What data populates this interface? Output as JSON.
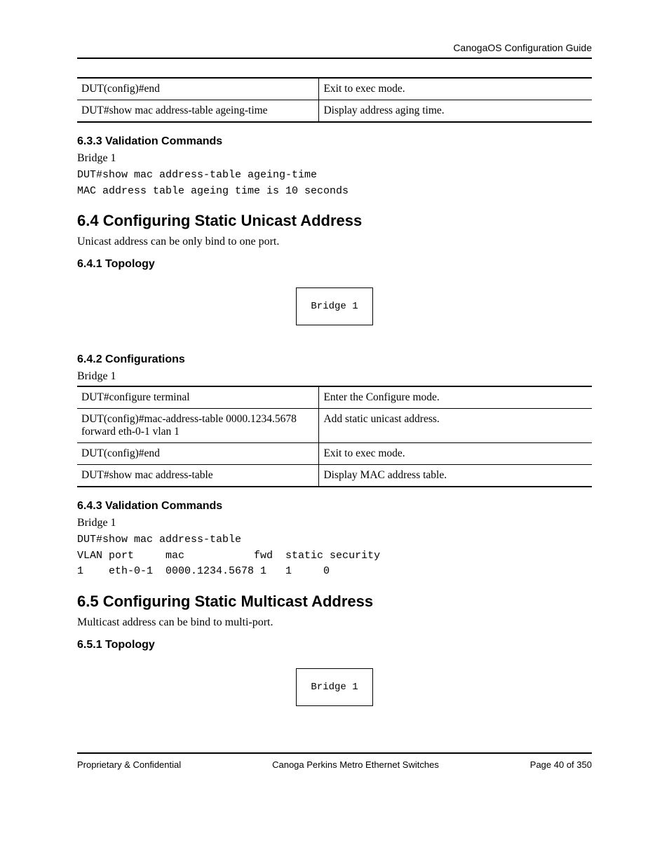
{
  "header": {
    "doc_title": "CanogaOS Configuration Guide"
  },
  "table1": {
    "rows": [
      {
        "cmd": "DUT(config)#end",
        "desc": "Exit to exec mode."
      },
      {
        "cmd": "DUT#show mac address-table ageing-time",
        "desc": "Display address aging time."
      }
    ]
  },
  "s633": {
    "heading": "6.3.3  Validation Commands",
    "bridge_label": "Bridge 1",
    "terminal": "DUT#show mac address-table ageing-time\nMAC address table ageing time is 10 seconds"
  },
  "s64": {
    "heading": "6.4 Configuring Static Unicast Address",
    "intro": "Unicast address can be only bind to one port."
  },
  "s641": {
    "heading": "6.4.1  Topology",
    "box": "Bridge 1"
  },
  "s642": {
    "heading": "6.4.2  Configurations",
    "bridge_label": "Bridge 1",
    "rows": [
      {
        "cmd": "DUT#configure terminal",
        "desc": "Enter the Configure mode."
      },
      {
        "cmd": "DUT(config)#mac-address-table 0000.1234.5678 forward eth-0-1 vlan 1",
        "desc": "Add static unicast address."
      },
      {
        "cmd": "DUT(config)#end",
        "desc": "Exit to exec mode."
      },
      {
        "cmd": "DUT#show mac address-table",
        "desc": "Display MAC address table."
      }
    ]
  },
  "s643": {
    "heading": "6.4.3  Validation Commands",
    "bridge_label": "Bridge 1",
    "terminal": "DUT#show mac address-table\nVLAN port     mac           fwd  static security\n1    eth-0-1  0000.1234.5678 1   1     0"
  },
  "s65": {
    "heading": "6.5 Configuring Static Multicast Address",
    "intro": "Multicast address can be bind to multi-port."
  },
  "s651": {
    "heading": "6.5.1  Topology",
    "box": "Bridge 1"
  },
  "footer": {
    "left": "Proprietary & Confidential",
    "center": "Canoga Perkins Metro Ethernet Switches",
    "right": "Page 40 of 350"
  }
}
